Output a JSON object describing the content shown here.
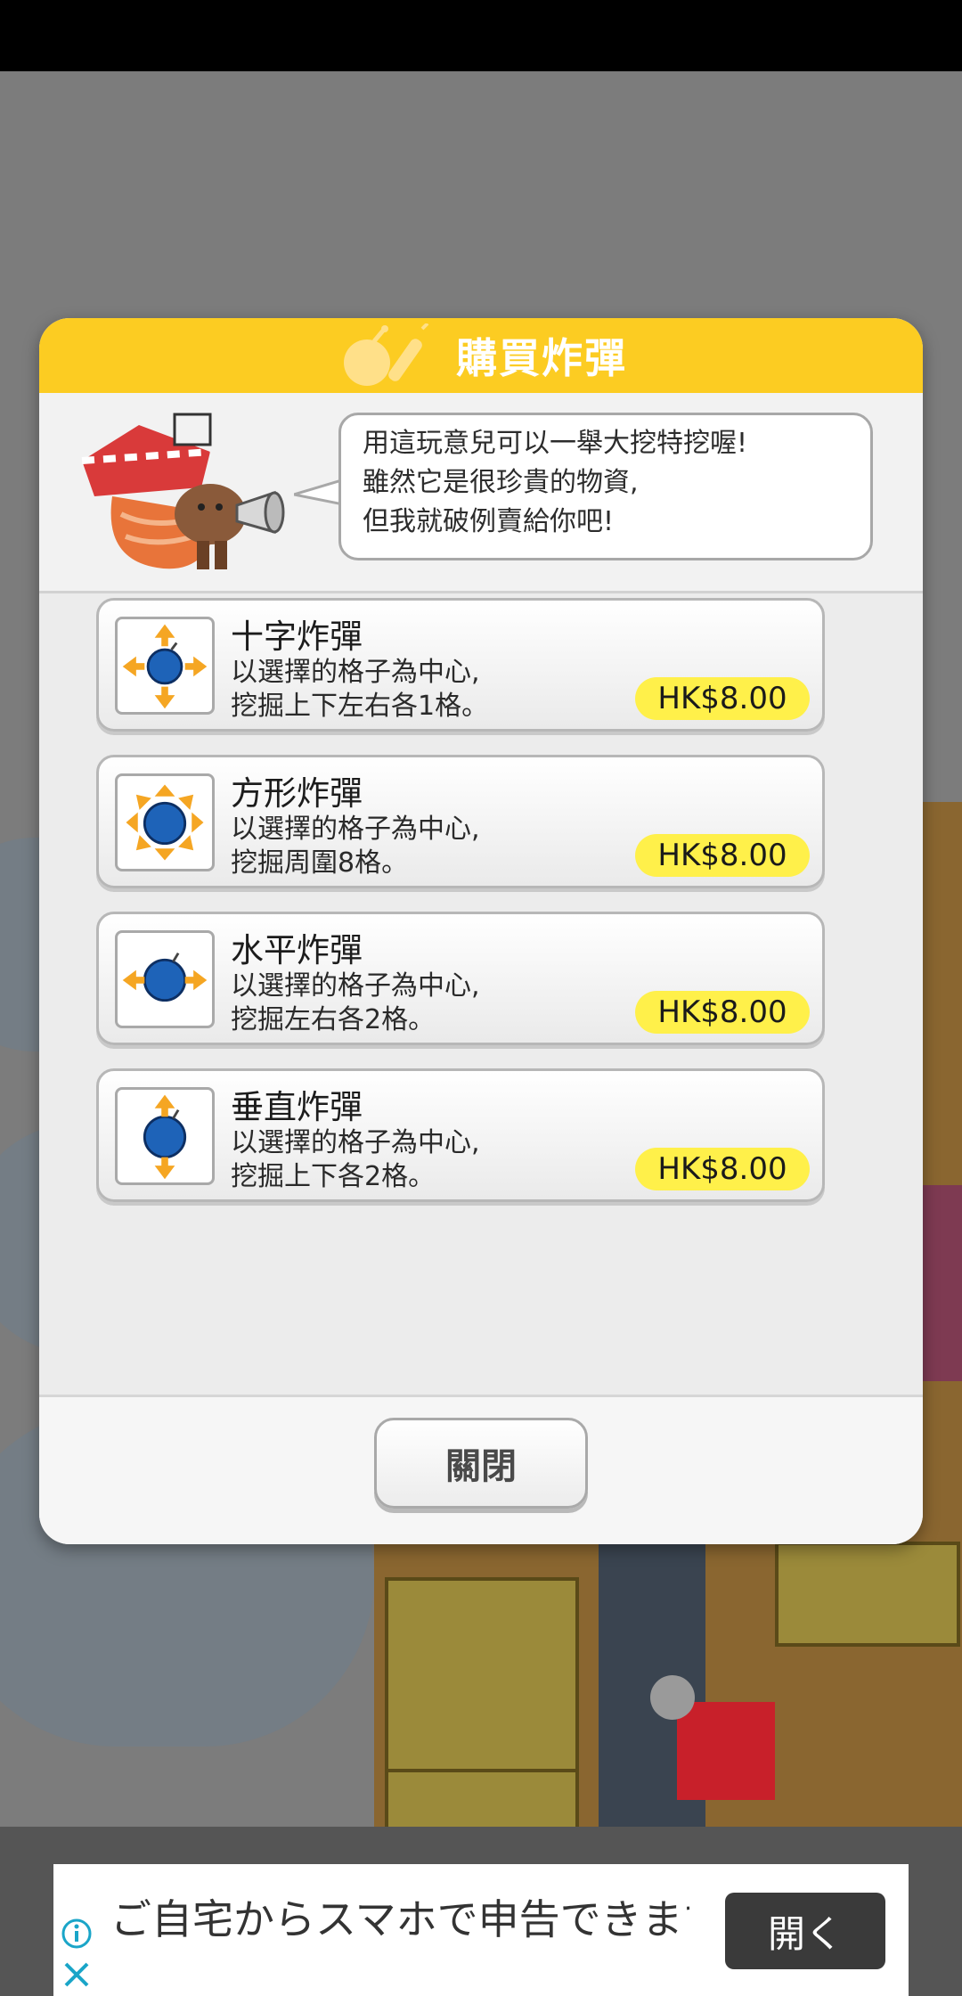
{
  "dialog": {
    "title": "購買炸彈",
    "speech": [
      "用這玩意兒可以一舉大挖特挖喔!",
      "雖然它是很珍貴的物資,",
      "但我就破例賣給你吧!"
    ],
    "items": [
      {
        "name": "十字炸彈",
        "desc_line1": "以選擇的格子為中心,",
        "desc_line2": "挖掘上下左右各1格。",
        "price": "HK$8.00",
        "icon": "cross-bomb-icon"
      },
      {
        "name": "方形炸彈",
        "desc_line1": "以選擇的格子為中心,",
        "desc_line2": "挖掘周圍8格。",
        "price": "HK$8.00",
        "icon": "square-bomb-icon"
      },
      {
        "name": "水平炸彈",
        "desc_line1": "以選擇的格子為中心,",
        "desc_line2": "挖掘左右各2格。",
        "price": "HK$8.00",
        "icon": "horizontal-bomb-icon"
      },
      {
        "name": "垂直炸彈",
        "desc_line1": "以選擇的格子為中心,",
        "desc_line2": "挖掘上下各2格。",
        "price": "HK$8.00",
        "icon": "vertical-bomb-icon"
      }
    ],
    "close_label": "關閉"
  },
  "ad": {
    "text": "ご自宅からスマホで申告できます",
    "button_label": "開く",
    "info_icon": "info-icon",
    "close_icon": "close-icon"
  },
  "colors": {
    "header": "#fccc22",
    "price_badge": "#fff04a",
    "bomb": "#1e63b8",
    "arrow": "#f5a623"
  }
}
